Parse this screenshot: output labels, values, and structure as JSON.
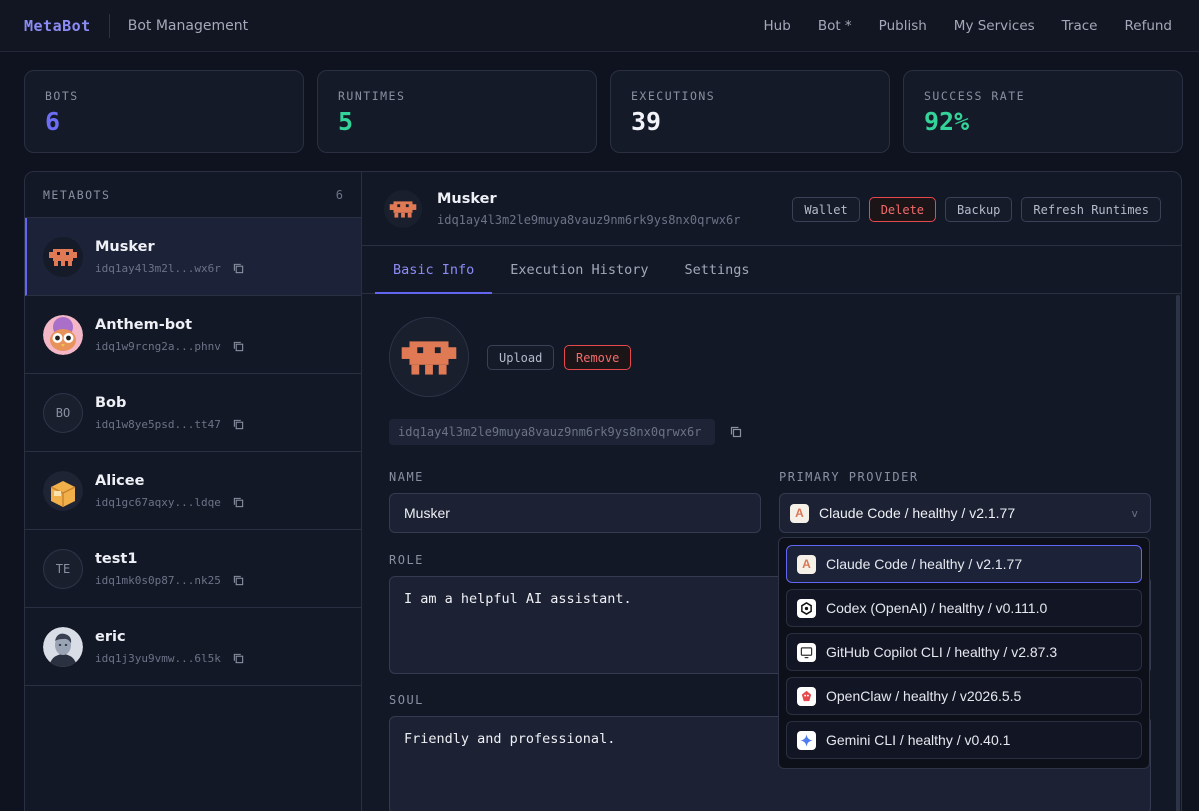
{
  "brand": "MetaBot",
  "page_title": "Bot Management",
  "nav": [
    "Hub",
    "Bot *",
    "Publish",
    "My Services",
    "Trace",
    "Refund"
  ],
  "stats": [
    {
      "label": "BOTS",
      "value": "6",
      "color": "#6d6ef5"
    },
    {
      "label": "RUNTIMES",
      "value": "5",
      "color": "#34d399"
    },
    {
      "label": "EXECUTIONS",
      "value": "39",
      "color": "#f1f3f8"
    },
    {
      "label": "SUCCESS RATE",
      "value": "92%",
      "color": "#34d399"
    }
  ],
  "sidebar": {
    "title": "METABOTS",
    "count": "6",
    "bots": [
      {
        "name": "Musker",
        "id": "idq1ay4l3m2l...wx6r",
        "avatar": "pixel-robot"
      },
      {
        "name": "Anthem-bot",
        "id": "idq1w9rcng2a...phnv",
        "avatar": "owl"
      },
      {
        "name": "Bob",
        "id": "idq1w8ye5psd...tt47",
        "avatar": "initials",
        "initials": "BO"
      },
      {
        "name": "Alicee",
        "id": "idq1gc67aqxy...ldqe",
        "avatar": "box"
      },
      {
        "name": "test1",
        "id": "idq1mk0s0p87...nk25",
        "avatar": "initials",
        "initials": "TE"
      },
      {
        "name": "eric",
        "id": "idq1j3yu9vmw...6l5k",
        "avatar": "portrait"
      }
    ]
  },
  "detail": {
    "name": "Musker",
    "id": "idq1ay4l3m2le9muya8vauz9nm6rk9ys8nx0qrwx6r",
    "actions": {
      "wallet": "Wallet",
      "delete": "Delete",
      "backup": "Backup",
      "refresh": "Refresh Runtimes"
    },
    "tabs": [
      "Basic Info",
      "Execution History",
      "Settings"
    ],
    "upload": "Upload",
    "remove": "Remove",
    "name_label": "NAME",
    "name_value": "Musker",
    "provider_label": "PRIMARY PROVIDER",
    "provider_value": "Claude Code / healthy / v2.1.77",
    "role_label": "ROLE",
    "role_value": "I am a helpful AI assistant.",
    "soul_label": "SOUL",
    "soul_value": "Friendly and professional.",
    "chevron": "v"
  },
  "providers": [
    {
      "label": "Claude Code / healthy / v2.1.77",
      "icon": "anthropic-icon",
      "color": "#d97757"
    },
    {
      "label": "Codex (OpenAI) / healthy / v0.111.0",
      "icon": "openai-icon",
      "color": "#ffffff"
    },
    {
      "label": "GitHub Copilot CLI / healthy / v2.87.3",
      "icon": "monitor-icon",
      "color": "#ffffff"
    },
    {
      "label": "OpenClaw / healthy / v2026.5.5",
      "icon": "lobster-icon",
      "color": "#e5484d"
    },
    {
      "label": "Gemini CLI / healthy / v0.40.1",
      "icon": "gemini-icon",
      "color": "#4f7df0"
    }
  ],
  "colors": {
    "accent": "#6366f1",
    "danger": "#e5484d",
    "robot": "#e07a55"
  }
}
